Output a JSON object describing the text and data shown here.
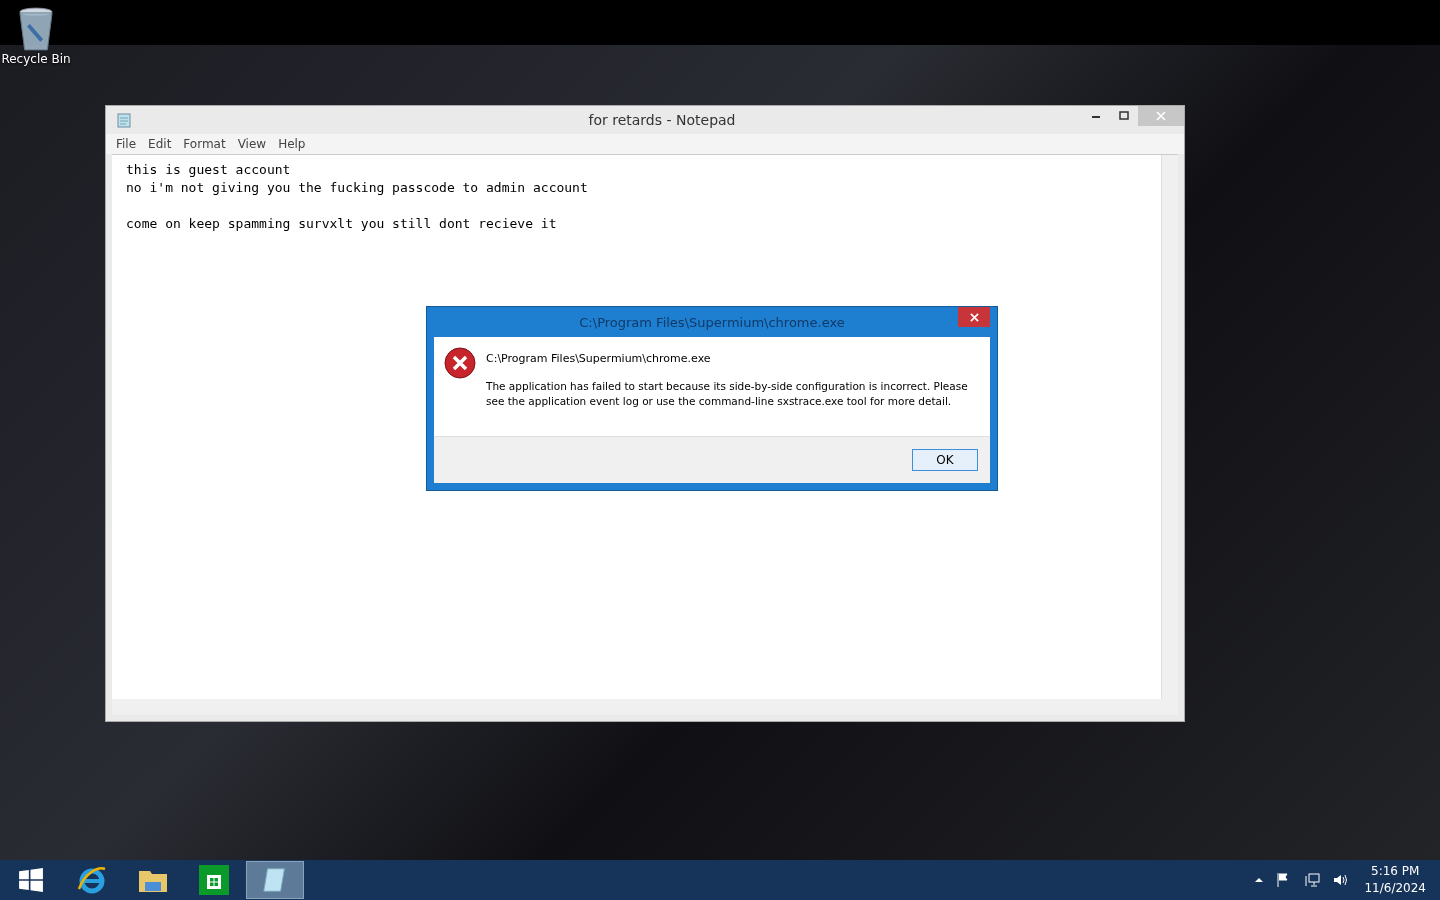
{
  "desktop": {
    "icons": [
      {
        "label": "Recycle Bin",
        "kind": "recycle-bin"
      }
    ]
  },
  "notepad": {
    "title": "for retards - Notepad",
    "menu": [
      "File",
      "Edit",
      "Format",
      "View",
      "Help"
    ],
    "text": "this is guest account\nno i'm not giving you the fucking passcode to admin account\n\ncome on keep spamming survxlt you still dont recieve it"
  },
  "dialog": {
    "title": "C:\\Program Files\\Supermium\\chrome.exe",
    "heading": "C:\\Program Files\\Supermium\\chrome.exe",
    "message": "The application has failed to start because its side-by-side configuration is incorrect. Please see the application event log or use the command-line sxstrace.exe tool for more detail.",
    "buttons": [
      "OK"
    ]
  },
  "taskbar": {
    "apps": [
      {
        "kind": "start",
        "selected": false
      },
      {
        "kind": "browser",
        "selected": false
      },
      {
        "kind": "files",
        "selected": false
      },
      {
        "kind": "store",
        "selected": false
      },
      {
        "kind": "notepad",
        "selected": true
      }
    ],
    "time": "5:16 PM",
    "date": "11/6/2024"
  }
}
